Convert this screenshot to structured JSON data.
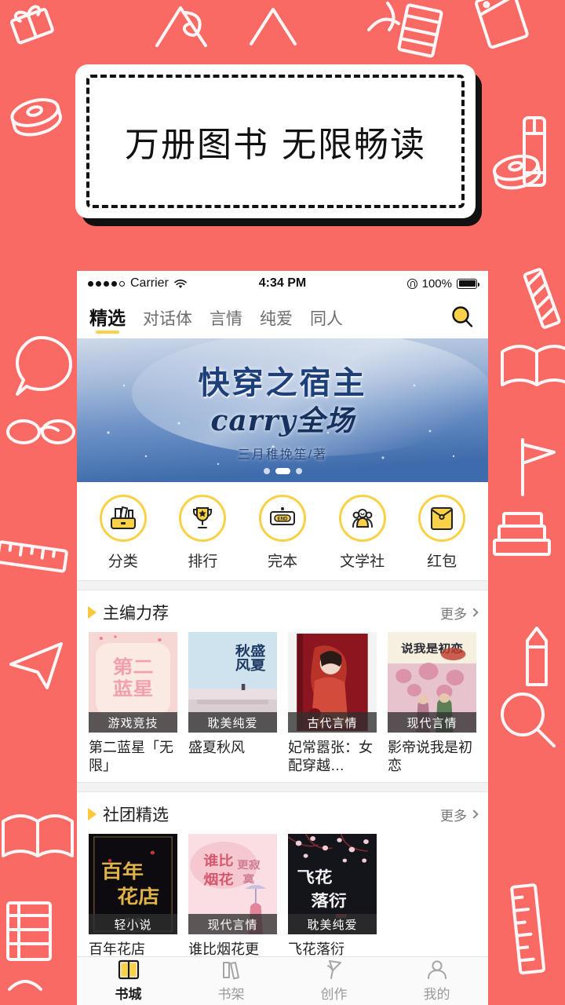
{
  "theme": {
    "background": "#fa6a64",
    "accent_yellow": "#f9d146",
    "badge_bg": "#303030"
  },
  "promo_banner": {
    "text": "万册图书  无限畅读"
  },
  "phone": {
    "status_bar": {
      "signal_dots": 5,
      "signal_filled": 4,
      "carrier": "Carrier",
      "wifi_icon": "wifi-icon",
      "time": "4:34 PM",
      "lock_icon": "rotation-lock-icon",
      "battery_percent": "100%",
      "battery_icon": "battery-full-icon"
    },
    "nav": {
      "tabs": [
        {
          "label": "精选",
          "active": true
        },
        {
          "label": "对话体",
          "active": false
        },
        {
          "label": "言情",
          "active": false
        },
        {
          "label": "纯爱",
          "active": false
        },
        {
          "label": "同人",
          "active": false
        }
      ],
      "search_icon": "search-icon"
    },
    "carousel": {
      "title_main": "快穿之宿主",
      "title_sub": "carry全场",
      "author": "三月稚挽笙/著",
      "dots": 3,
      "active_dot": 1
    },
    "quick_entries": [
      {
        "label": "分类",
        "icon": "category-icon"
      },
      {
        "label": "排行",
        "icon": "trophy-icon"
      },
      {
        "label": "完本",
        "icon": "end-sign-icon"
      },
      {
        "label": "文学社",
        "icon": "people-group-icon"
      },
      {
        "label": "红包",
        "icon": "red-envelope-icon"
      }
    ],
    "sections": [
      {
        "title": "主编力荐",
        "more_label": "更多",
        "books": [
          {
            "title": "第二蓝星「无限」",
            "badge": "游戏竞技",
            "cover": "pink-floral"
          },
          {
            "title": "盛夏秋风",
            "badge": "耽美纯爱",
            "cover": "blue-school"
          },
          {
            "title": "妃常嚣张：女配穿越…",
            "badge": "古代言情",
            "cover": "red-ancient"
          },
          {
            "title": "影帝说我是初恋",
            "badge": "现代言情",
            "cover": "pink-blossom"
          }
        ]
      },
      {
        "title": "社团精选",
        "more_label": "更多",
        "books": [
          {
            "title": "百年花店",
            "badge": "轻小说",
            "cover": "black-gold"
          },
          {
            "title": "谁比烟花更",
            "badge": "现代言情",
            "cover": "pink-umbrella"
          },
          {
            "title": "飞花落衍",
            "badge": "耽美纯爱",
            "cover": "dark-blossom"
          }
        ]
      }
    ],
    "tabbar": [
      {
        "label": "书城",
        "icon": "book-store-icon",
        "active": true
      },
      {
        "label": "书架",
        "icon": "bookshelf-icon",
        "active": false
      },
      {
        "label": "创作",
        "icon": "pen-create-icon",
        "active": false
      },
      {
        "label": "我的",
        "icon": "user-profile-icon",
        "active": false
      }
    ]
  }
}
